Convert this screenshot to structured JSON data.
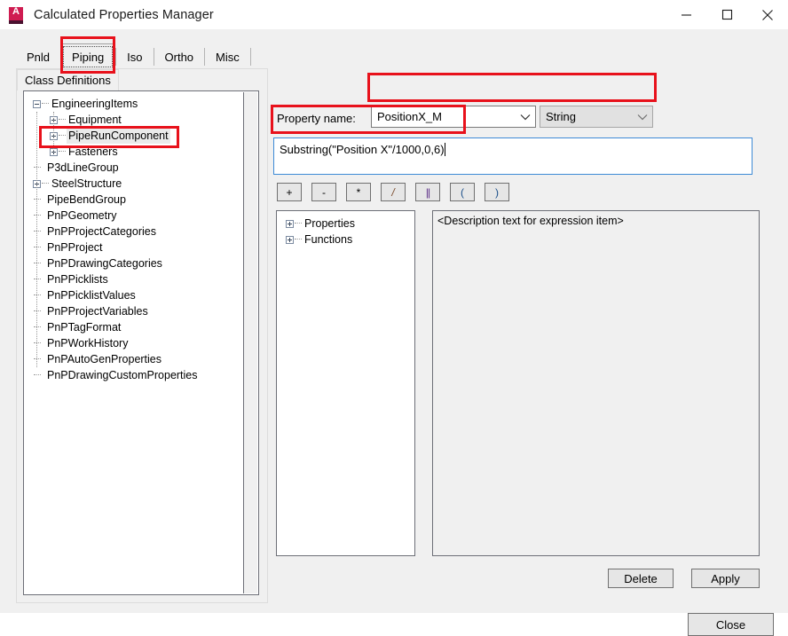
{
  "window": {
    "title": "Calculated Properties Manager",
    "icon": "autocad-plant3d-icon",
    "controls": {
      "minimize": "minimize-icon",
      "maximize": "maximize-icon",
      "close": "close-icon"
    }
  },
  "tabs": [
    {
      "label": "Pnld",
      "selected": false
    },
    {
      "label": "Piping",
      "selected": true
    },
    {
      "label": "Iso",
      "selected": false
    },
    {
      "label": "Ortho",
      "selected": false
    },
    {
      "label": "Misc",
      "selected": false
    }
  ],
  "tab_page": {
    "label": "Class Definitions"
  },
  "class_tree": [
    {
      "label": "EngineeringItems",
      "indent": 0,
      "expander": "minus",
      "selected": false
    },
    {
      "label": "Equipment",
      "indent": 1,
      "expander": "plus",
      "selected": false
    },
    {
      "label": "PipeRunComponent",
      "indent": 1,
      "expander": "plus",
      "selected": true
    },
    {
      "label": "Fasteners",
      "indent": 1,
      "expander": "plus",
      "selected": false
    },
    {
      "label": "P3dLineGroup",
      "indent": 0,
      "expander": "none",
      "selected": false
    },
    {
      "label": "SteelStructure",
      "indent": 0,
      "expander": "plus",
      "selected": false
    },
    {
      "label": "PipeBendGroup",
      "indent": 0,
      "expander": "none",
      "selected": false
    },
    {
      "label": "PnPGeometry",
      "indent": 0,
      "expander": "none",
      "selected": false
    },
    {
      "label": "PnPProjectCategories",
      "indent": 0,
      "expander": "none",
      "selected": false
    },
    {
      "label": "PnPProject",
      "indent": 0,
      "expander": "none",
      "selected": false
    },
    {
      "label": "PnPDrawingCategories",
      "indent": 0,
      "expander": "none",
      "selected": false
    },
    {
      "label": "PnPPicklists",
      "indent": 0,
      "expander": "none",
      "selected": false
    },
    {
      "label": "PnPPicklistValues",
      "indent": 0,
      "expander": "none",
      "selected": false
    },
    {
      "label": "PnPProjectVariables",
      "indent": 0,
      "expander": "none",
      "selected": false
    },
    {
      "label": "PnPTagFormat",
      "indent": 0,
      "expander": "none",
      "selected": false
    },
    {
      "label": "PnPWorkHistory",
      "indent": 0,
      "expander": "none",
      "selected": false
    },
    {
      "label": "PnPAutoGenProperties",
      "indent": 0,
      "expander": "none",
      "selected": false
    },
    {
      "label": "PnPDrawingCustomProperties",
      "indent": 0,
      "expander": "none",
      "selected": false
    }
  ],
  "property": {
    "label": "Property name:",
    "name_value": "PositionX_M",
    "type_value": "String"
  },
  "expression": {
    "value": "Substring(\"Position X\"/1000,0,6)"
  },
  "operators": [
    {
      "label": "+",
      "name": "plus"
    },
    {
      "label": "-",
      "name": "minus"
    },
    {
      "label": "*",
      "name": "asterisk"
    },
    {
      "label": "/",
      "name": "slash"
    },
    {
      "label": "||",
      "name": "concat"
    },
    {
      "label": "(",
      "name": "open-paren"
    },
    {
      "label": ")",
      "name": "close-paren"
    }
  ],
  "picker_tree": [
    {
      "label": "Properties",
      "expander": "plus"
    },
    {
      "label": "Functions",
      "expander": "plus"
    }
  ],
  "description": {
    "text": "<Description text for expression item>"
  },
  "buttons": {
    "delete": "Delete",
    "apply": "Apply",
    "close": "Close"
  },
  "colors": {
    "annotation_red": "#e8111b",
    "brand": "#cf1c51",
    "focus_border": "#3d8ad6",
    "dialog_bg": "#f0f0f0"
  }
}
